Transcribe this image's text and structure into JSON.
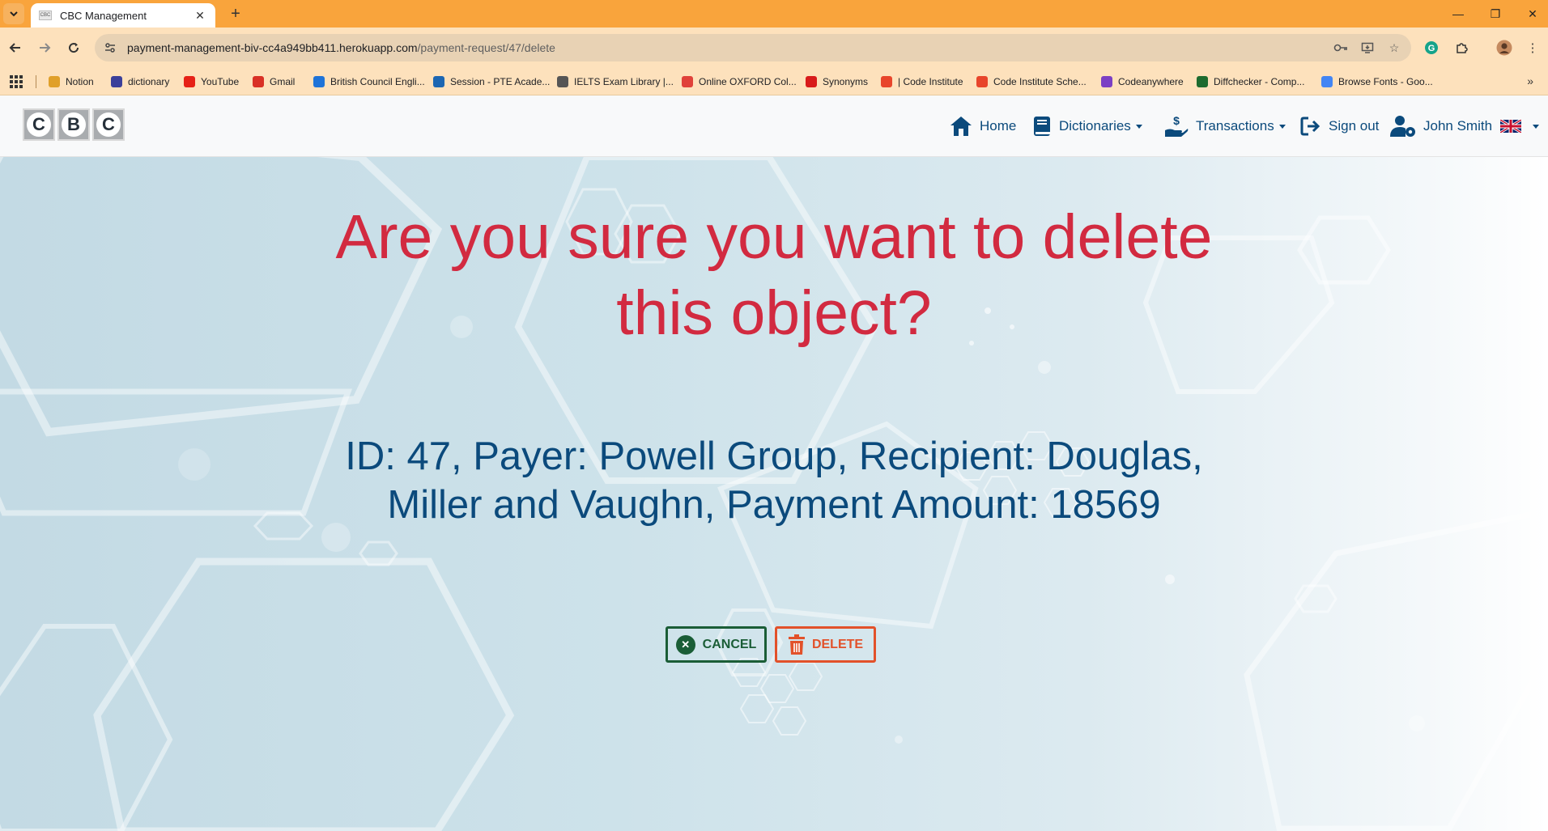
{
  "browser": {
    "tab_title": "CBC Management",
    "tab_favicon_text": "CBC",
    "url_host": "payment-management-biv-cc4a949bb411.herokuapp.com",
    "url_path": "/payment-request/47/delete",
    "bookmarks": [
      {
        "label": "Notion",
        "color": "#e0a02a"
      },
      {
        "label": "dictionary",
        "color": "#3b3f9a"
      },
      {
        "label": "YouTube",
        "color": "#e62117"
      },
      {
        "label": "Gmail",
        "color": "#d93025"
      },
      {
        "label": "British Council Engli...",
        "color": "#1e73d8"
      },
      {
        "label": "Session - PTE Acade...",
        "color": "#1c66b2"
      },
      {
        "label": "IELTS Exam Library |...",
        "color": "#555555"
      },
      {
        "label": "Online OXFORD Col...",
        "color": "#e0413a"
      },
      {
        "label": "Synonyms",
        "color": "#d81b1b"
      },
      {
        "label": "| Code Institute",
        "color": "#e8452b"
      },
      {
        "label": "Code Institute Sche...",
        "color": "#e8452b"
      },
      {
        "label": "Codeanywhere",
        "color": "#7b3fc4"
      },
      {
        "label": "Diffchecker - Comp...",
        "color": "#1d6b2f"
      },
      {
        "label": "Browse Fonts - Goo...",
        "color": "#4285f4"
      }
    ]
  },
  "nav": {
    "logo_letters": [
      "C",
      "B",
      "C"
    ],
    "home": "Home",
    "dictionaries": "Dictionaries",
    "transactions": "Transactions",
    "sign_out": "Sign out",
    "user": "John Smith"
  },
  "main": {
    "heading": "Are you sure you want to delete this object?",
    "details": "ID: 47, Payer: Powell Group, Recipient: Douglas, Miller and Vaughn, Payment Amount: 18569",
    "cancel_label": "CANCEL",
    "delete_label": "DELETE"
  },
  "colors": {
    "heading": "#d22a40",
    "details": "#0b4a7c",
    "cancel": "#1a5d36",
    "delete": "#e2512a",
    "tabbar": "#f9a43c",
    "toolbar": "#fde1bc"
  }
}
